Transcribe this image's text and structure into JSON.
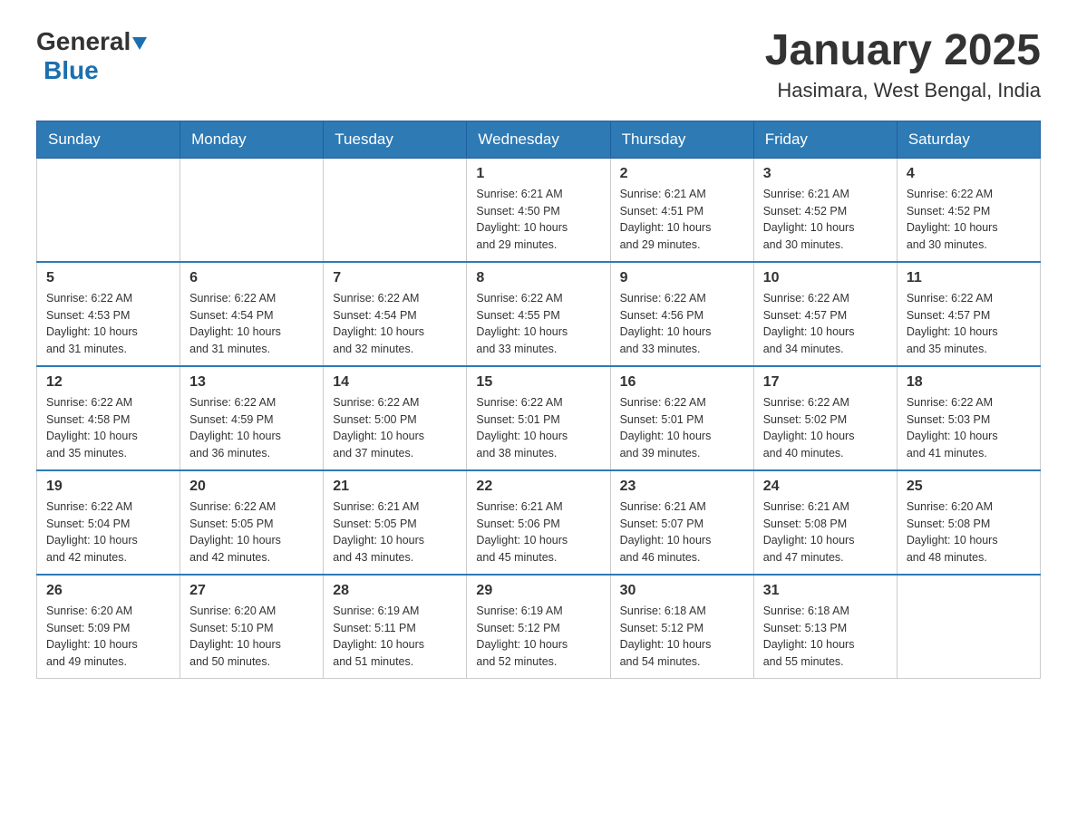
{
  "header": {
    "logo_general": "General",
    "logo_blue": "Blue",
    "month_year": "January 2025",
    "location": "Hasimara, West Bengal, India"
  },
  "days_of_week": [
    "Sunday",
    "Monday",
    "Tuesday",
    "Wednesday",
    "Thursday",
    "Friday",
    "Saturday"
  ],
  "weeks": [
    [
      {
        "day": "",
        "info": ""
      },
      {
        "day": "",
        "info": ""
      },
      {
        "day": "",
        "info": ""
      },
      {
        "day": "1",
        "info": "Sunrise: 6:21 AM\nSunset: 4:50 PM\nDaylight: 10 hours\nand 29 minutes."
      },
      {
        "day": "2",
        "info": "Sunrise: 6:21 AM\nSunset: 4:51 PM\nDaylight: 10 hours\nand 29 minutes."
      },
      {
        "day": "3",
        "info": "Sunrise: 6:21 AM\nSunset: 4:52 PM\nDaylight: 10 hours\nand 30 minutes."
      },
      {
        "day": "4",
        "info": "Sunrise: 6:22 AM\nSunset: 4:52 PM\nDaylight: 10 hours\nand 30 minutes."
      }
    ],
    [
      {
        "day": "5",
        "info": "Sunrise: 6:22 AM\nSunset: 4:53 PM\nDaylight: 10 hours\nand 31 minutes."
      },
      {
        "day": "6",
        "info": "Sunrise: 6:22 AM\nSunset: 4:54 PM\nDaylight: 10 hours\nand 31 minutes."
      },
      {
        "day": "7",
        "info": "Sunrise: 6:22 AM\nSunset: 4:54 PM\nDaylight: 10 hours\nand 32 minutes."
      },
      {
        "day": "8",
        "info": "Sunrise: 6:22 AM\nSunset: 4:55 PM\nDaylight: 10 hours\nand 33 minutes."
      },
      {
        "day": "9",
        "info": "Sunrise: 6:22 AM\nSunset: 4:56 PM\nDaylight: 10 hours\nand 33 minutes."
      },
      {
        "day": "10",
        "info": "Sunrise: 6:22 AM\nSunset: 4:57 PM\nDaylight: 10 hours\nand 34 minutes."
      },
      {
        "day": "11",
        "info": "Sunrise: 6:22 AM\nSunset: 4:57 PM\nDaylight: 10 hours\nand 35 minutes."
      }
    ],
    [
      {
        "day": "12",
        "info": "Sunrise: 6:22 AM\nSunset: 4:58 PM\nDaylight: 10 hours\nand 35 minutes."
      },
      {
        "day": "13",
        "info": "Sunrise: 6:22 AM\nSunset: 4:59 PM\nDaylight: 10 hours\nand 36 minutes."
      },
      {
        "day": "14",
        "info": "Sunrise: 6:22 AM\nSunset: 5:00 PM\nDaylight: 10 hours\nand 37 minutes."
      },
      {
        "day": "15",
        "info": "Sunrise: 6:22 AM\nSunset: 5:01 PM\nDaylight: 10 hours\nand 38 minutes."
      },
      {
        "day": "16",
        "info": "Sunrise: 6:22 AM\nSunset: 5:01 PM\nDaylight: 10 hours\nand 39 minutes."
      },
      {
        "day": "17",
        "info": "Sunrise: 6:22 AM\nSunset: 5:02 PM\nDaylight: 10 hours\nand 40 minutes."
      },
      {
        "day": "18",
        "info": "Sunrise: 6:22 AM\nSunset: 5:03 PM\nDaylight: 10 hours\nand 41 minutes."
      }
    ],
    [
      {
        "day": "19",
        "info": "Sunrise: 6:22 AM\nSunset: 5:04 PM\nDaylight: 10 hours\nand 42 minutes."
      },
      {
        "day": "20",
        "info": "Sunrise: 6:22 AM\nSunset: 5:05 PM\nDaylight: 10 hours\nand 42 minutes."
      },
      {
        "day": "21",
        "info": "Sunrise: 6:21 AM\nSunset: 5:05 PM\nDaylight: 10 hours\nand 43 minutes."
      },
      {
        "day": "22",
        "info": "Sunrise: 6:21 AM\nSunset: 5:06 PM\nDaylight: 10 hours\nand 45 minutes."
      },
      {
        "day": "23",
        "info": "Sunrise: 6:21 AM\nSunset: 5:07 PM\nDaylight: 10 hours\nand 46 minutes."
      },
      {
        "day": "24",
        "info": "Sunrise: 6:21 AM\nSunset: 5:08 PM\nDaylight: 10 hours\nand 47 minutes."
      },
      {
        "day": "25",
        "info": "Sunrise: 6:20 AM\nSunset: 5:08 PM\nDaylight: 10 hours\nand 48 minutes."
      }
    ],
    [
      {
        "day": "26",
        "info": "Sunrise: 6:20 AM\nSunset: 5:09 PM\nDaylight: 10 hours\nand 49 minutes."
      },
      {
        "day": "27",
        "info": "Sunrise: 6:20 AM\nSunset: 5:10 PM\nDaylight: 10 hours\nand 50 minutes."
      },
      {
        "day": "28",
        "info": "Sunrise: 6:19 AM\nSunset: 5:11 PM\nDaylight: 10 hours\nand 51 minutes."
      },
      {
        "day": "29",
        "info": "Sunrise: 6:19 AM\nSunset: 5:12 PM\nDaylight: 10 hours\nand 52 minutes."
      },
      {
        "day": "30",
        "info": "Sunrise: 6:18 AM\nSunset: 5:12 PM\nDaylight: 10 hours\nand 54 minutes."
      },
      {
        "day": "31",
        "info": "Sunrise: 6:18 AM\nSunset: 5:13 PM\nDaylight: 10 hours\nand 55 minutes."
      },
      {
        "day": "",
        "info": ""
      }
    ]
  ]
}
